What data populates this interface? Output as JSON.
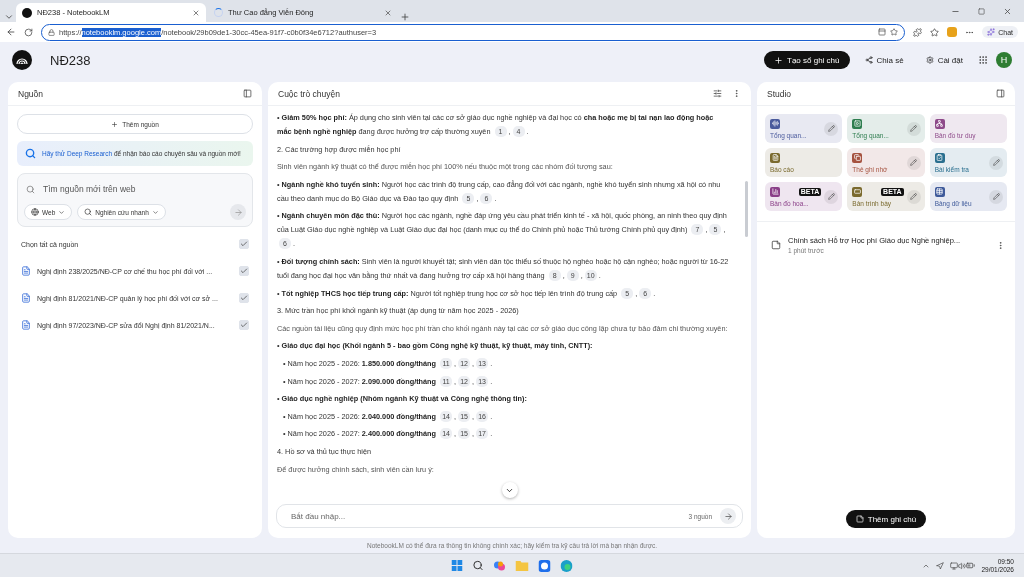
{
  "browser": {
    "tabs": [
      {
        "title": "NĐ238 - NotebookLM",
        "selected": true,
        "loading": false
      },
      {
        "title": "Thư Cao đẳng Viễn Đông",
        "selected": false,
        "loading": true
      }
    ],
    "url": {
      "scheme": "https://",
      "host": "notebooklm.google.com",
      "path": "/notebook/29b09de1-30cc-45ea-91f7-c0b0f34e6712?authuser=3",
      "host_selected": true
    },
    "chat_button": "Chat"
  },
  "header": {
    "title": "NĐ238",
    "create_button": "Tạo sổ ghi chú",
    "share_button": "Chia sẻ",
    "settings_button": "Cài đặt",
    "avatar": "H"
  },
  "sources": {
    "title": "Nguồn",
    "add_button": "Thêm nguồn",
    "banner": {
      "link": "Hãy thử Deep Research",
      "text": "để nhận báo cáo chuyên sâu và nguồn mới!"
    },
    "search": {
      "placeholder": "Tìm nguồn mới trên web",
      "source_chip": "Web",
      "mode_chip": "Nghiên cứu nhanh"
    },
    "select_all": {
      "label": "Chọn tất cả nguồn",
      "checked": true
    },
    "items": [
      {
        "title": "Nghị định 238/2025/NĐ-CP cơ chế thu học phí đối với ...",
        "checked": true
      },
      {
        "title": "Nghị định 81/2021/NĐ-CP quản lý học phí đối với cơ sở ...",
        "checked": true
      },
      {
        "title": "Nghị định 97/2023/NĐ-CP sửa đổi Nghị định 81/2021/N...",
        "checked": true
      }
    ]
  },
  "chat": {
    "title": "Cuộc trò chuyện",
    "cite_separator": ",",
    "cite_end": ".",
    "blocks": [
      {
        "kind": "bullet",
        "text": "• **Giảm 50% học phí:** Áp dụng cho sinh viên tại các cơ sở giáo dục nghề nghiệp và đại học có **cha hoặc mẹ bị tai nạn lao động hoặc mắc bệnh nghề nghiệp** đang được hưởng trợ cấp thường xuyên",
        "cites": [
          "1",
          "4"
        ]
      },
      {
        "kind": "heading",
        "text": "2. Các trường hợp được miễn học phí"
      },
      {
        "kind": "para",
        "text": "Sinh viên ngành kỹ thuật có thể được miễn học phí 100% nếu thuộc một trong các nhóm đối tượng sau:"
      },
      {
        "kind": "bullet",
        "text": "• **Ngành nghề khó tuyển sinh:** Người học các trình độ trung cấp, cao đẳng đối với các ngành, nghề khó tuyển sinh nhưng xã hội có nhu cầu theo danh mục do Bộ Giáo dục và Đào tạo quy định",
        "cites": [
          "5",
          "6"
        ]
      },
      {
        "kind": "bullet",
        "text": "• **Ngành chuyên môn đặc thù:** Người học các ngành, nghề đáp ứng yêu cầu phát triển kinh tế - xã hội, quốc phòng, an ninh theo quy định của Luật Giáo dục nghề nghiệp và Luật Giáo dục đại học (danh mục cụ thể do Chính phủ hoặc Thủ tướng Chính phủ quy định)",
        "cites": [
          "7",
          "5",
          "6"
        ]
      },
      {
        "kind": "bullet",
        "text": "• **Đối tượng chính sách:** Sinh viên là người khuyết tật; sinh viên dân tộc thiểu số thuộc hộ nghèo hoặc hộ cận nghèo; hoặc người từ 16-22 tuổi đang học đại học văn bằng thứ nhất và đang hưởng trợ cấp xã hội hàng tháng",
        "cites": [
          "8",
          "9",
          "10"
        ]
      },
      {
        "kind": "bullet",
        "text": "• **Tốt nghiệp THCS học tiếp trung cấp:** Người tốt nghiệp trung học cơ sở học tiếp lên trình độ trung cấp",
        "cites": [
          "5",
          "6"
        ]
      },
      {
        "kind": "heading",
        "text": "3. Mức trần học phí khối ngành kỹ thuật (áp dụng từ năm học 2025 - 2026)"
      },
      {
        "kind": "para",
        "text": "Các nguồn tài liệu cũng quy định mức học phí trần cho khối ngành này tại các cơ sở giáo dục công lập chưa tự bảo đảm chi thường xuyên:"
      },
      {
        "kind": "bullet",
        "text": "• **Giáo dục đại học (Khối ngành 5 - bao gồm Công nghệ kỹ thuật, kỹ thuật, máy tính, CNTT):**"
      },
      {
        "kind": "sub",
        "text": "• Năm học 2025 - 2026: **1.850.000 đồng/tháng**",
        "cites": [
          "11",
          "12",
          "13"
        ]
      },
      {
        "kind": "sub",
        "text": "• Năm học 2026 - 2027: **2.090.000 đồng/tháng**",
        "cites": [
          "11",
          "12",
          "13"
        ]
      },
      {
        "kind": "bullet",
        "text": "• **Giáo dục nghề nghiệp (Nhóm ngành Kỹ thuật và Công nghệ thông tin):**"
      },
      {
        "kind": "sub",
        "text": "• Năm học 2025 - 2026: **2.040.000 đồng/tháng**",
        "cites": [
          "14",
          "15",
          "16"
        ]
      },
      {
        "kind": "sub",
        "text": "• Năm học 2026 - 2027: **2.400.000 đồng/tháng**",
        "cites": [
          "14",
          "15",
          "17"
        ]
      },
      {
        "kind": "heading",
        "text": "4. Hồ sơ và thủ tục thực hiện"
      },
      {
        "kind": "para",
        "text": "Để được hưởng chính sách, sinh viên cần lưu ý:"
      }
    ],
    "input": {
      "placeholder": "Bắt đầu nhập...",
      "source_count": "3 nguồn"
    }
  },
  "studio": {
    "title": "Studio",
    "tiles": [
      {
        "label": "Tổng quan...",
        "color": "#4a5a9c",
        "editable": true
      },
      {
        "label": "Tổng quan...",
        "color": "#2e7d4f",
        "editable": true
      },
      {
        "label": "Bản đồ tư duy",
        "color": "#8e4a8a",
        "editable": false
      },
      {
        "label": "Báo cáo",
        "color": "#7a6a2e",
        "editable": false
      },
      {
        "label": "Thẻ ghi nhớ",
        "color": "#a5523f",
        "editable": true
      },
      {
        "label": "Bài kiểm tra",
        "color": "#2a6f8f",
        "editable": true
      },
      {
        "label": "Bản đồ hoa...",
        "color": "#8a3f88",
        "editable": true,
        "badge": "BETA"
      },
      {
        "label": "Bản trình bày",
        "color": "#7a6a2e",
        "editable": true,
        "badge": "BETA"
      },
      {
        "label": "Bảng dữ liệu",
        "color": "#3f5a9a",
        "editable": true
      }
    ],
    "notes": [
      {
        "title": "Chính sách Hỗ trợ Học phí Giáo dục Nghề nghiệp...",
        "time": "1 phút trước"
      }
    ],
    "add_note_button": "Thêm ghi chú"
  },
  "disclaimer": "NotebookLM có thể đưa ra thông tin không chính xác; hãy kiểm tra kỹ câu trả lời mà bạn nhận được.",
  "taskbar": {
    "time": "09:50",
    "date": "29/01/2026"
  }
}
